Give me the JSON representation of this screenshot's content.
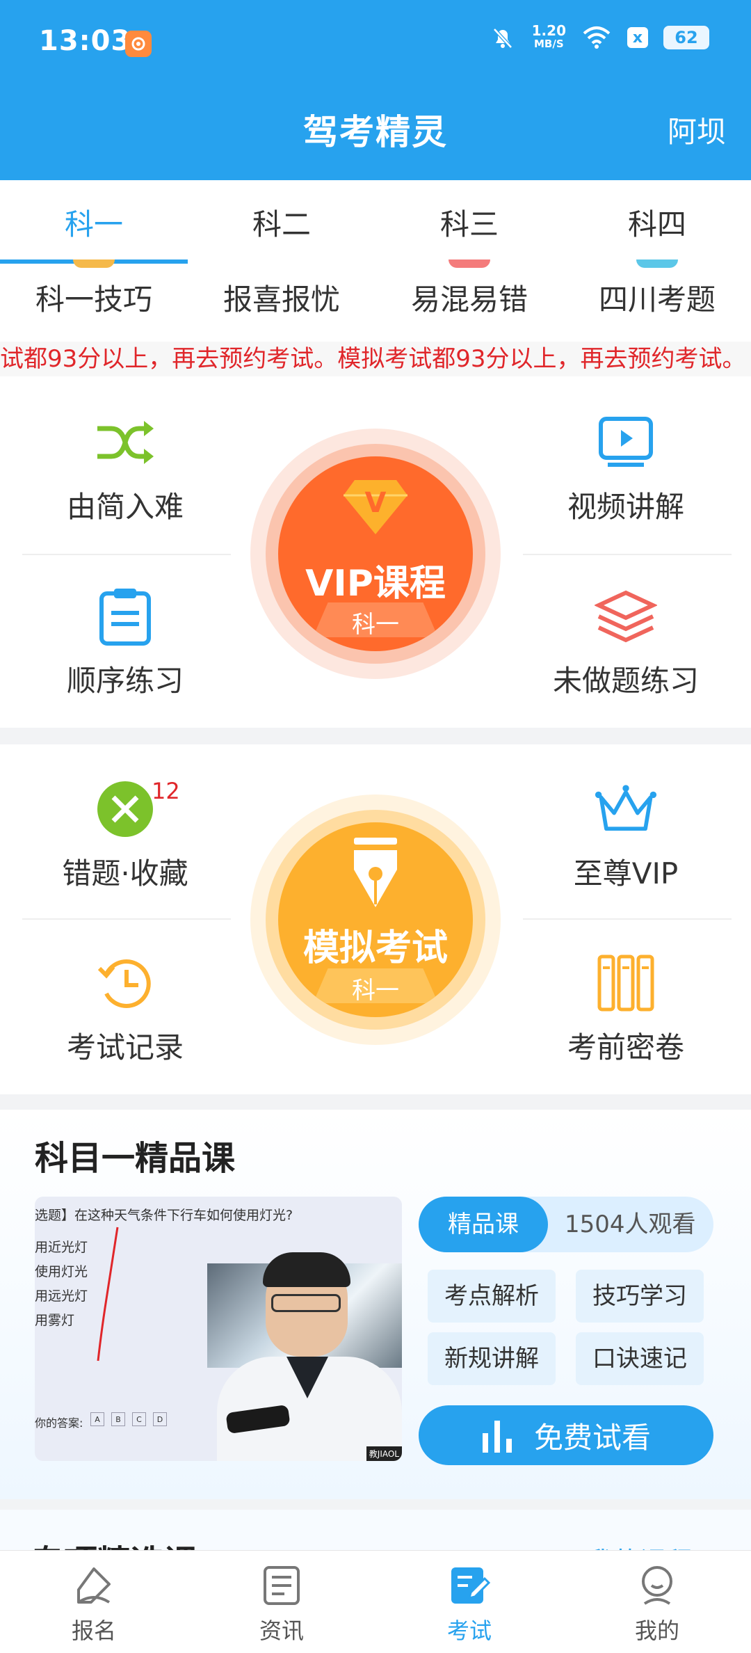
{
  "status": {
    "time": "13:03",
    "net_speed_top": "1.20",
    "net_speed_bottom": "MB/S",
    "battery": "62",
    "x_badge": "x"
  },
  "header": {
    "title": "驾考精灵",
    "location": "阿坝"
  },
  "subject_tabs": [
    "科一",
    "科二",
    "科三",
    "科四"
  ],
  "quick_links": [
    "科一技巧",
    "报喜报忧",
    "易混易错",
    "四川考题"
  ],
  "marquee_text": "试都93分以上，再去预约考试。模拟考试都93分以上，再去预约考试。",
  "practice": {
    "easy_to_hard": "由简入难",
    "video_explain": "视频讲解",
    "sequential": "顺序练习",
    "unanswered": "未做题练习",
    "vip_course": "VIP课程",
    "vip_subject": "科一",
    "vip_letter": "V"
  },
  "exam": {
    "mistakes": "错题·收藏",
    "mistakes_count": "12",
    "supreme_vip": "至尊VIP",
    "exam_records": "考试记录",
    "secret_papers": "考前密卷",
    "mock_exam": "模拟考试",
    "mock_subject": "科一"
  },
  "course": {
    "title": "科目一精品课",
    "video_question": "选题】在这种天气条件下行车如何使用灯光?",
    "video_options": [
      "用近光灯",
      "使用灯光",
      "用远光灯",
      "用雾灯"
    ],
    "video_answer_label": "你的答案:",
    "video_answer_choices": [
      "A",
      "B",
      "C",
      "D"
    ],
    "video_badge": "教JIAOL",
    "tag_active": "精品课",
    "viewers": "1504人观看",
    "chips": [
      "考点解析",
      "技巧学习",
      "新规讲解",
      "口诀速记"
    ],
    "free_preview": "免费试看"
  },
  "special": {
    "title": "专项精选课",
    "my_courses": "我的课程 >"
  },
  "bottom_nav": [
    "报名",
    "资讯",
    "考试",
    "我的"
  ],
  "colors": {
    "primary": "#27a2ee",
    "vip_orange": "#ff6a2c",
    "mock_yellow": "#fdb02e",
    "marquee_red": "#e0262a",
    "green": "#7cc22b"
  }
}
